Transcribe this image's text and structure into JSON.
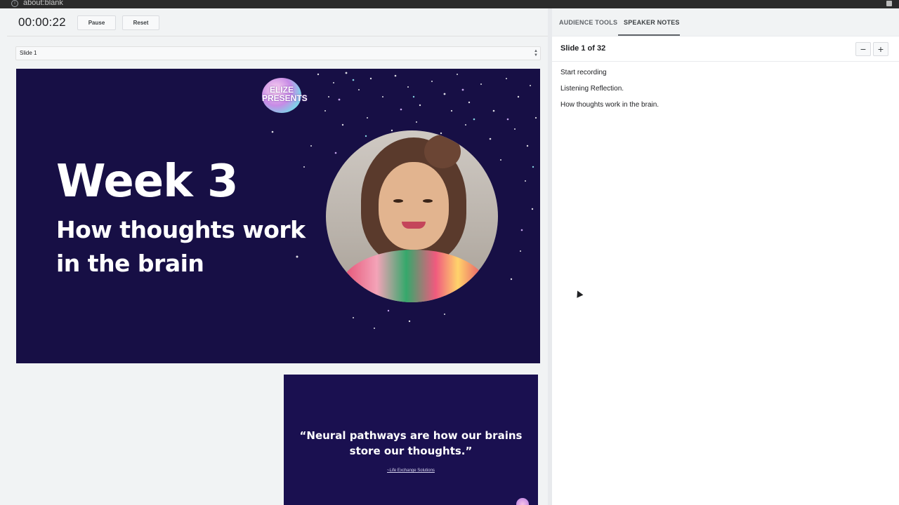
{
  "browser": {
    "url": "about:blank"
  },
  "presenter": {
    "timer": "00:00:22",
    "pause_label": "Pause",
    "reset_label": "Reset",
    "slide_select": {
      "selected": "Slide 1"
    }
  },
  "current_slide": {
    "logo_line1": "ELIZE",
    "logo_line2": "PRESENTS",
    "heading": "Week 3",
    "subtitle": "How thoughts work in the brain"
  },
  "next_slide": {
    "quote": "“Neural pathways are how our brains store our thoughts.”",
    "source": "~Life Exchange Solutions"
  },
  "side_panel": {
    "tabs": [
      {
        "label": "AUDIENCE TOOLS",
        "active": false
      },
      {
        "label": "SPEAKER NOTES",
        "active": true
      }
    ],
    "slide_count": "Slide 1 of 32",
    "zoom_out_label": "−",
    "zoom_in_label": "+",
    "notes": [
      "Start recording",
      "Listening Reflection.",
      "How thoughts work in the brain."
    ]
  },
  "colors": {
    "slide_bg": "#170f45",
    "panel_bg": "#ffffff",
    "app_bg": "#f1f3f4"
  },
  "icons": [
    "info-icon",
    "extension-icon",
    "select-arrows-icon",
    "cursor-icon"
  ]
}
